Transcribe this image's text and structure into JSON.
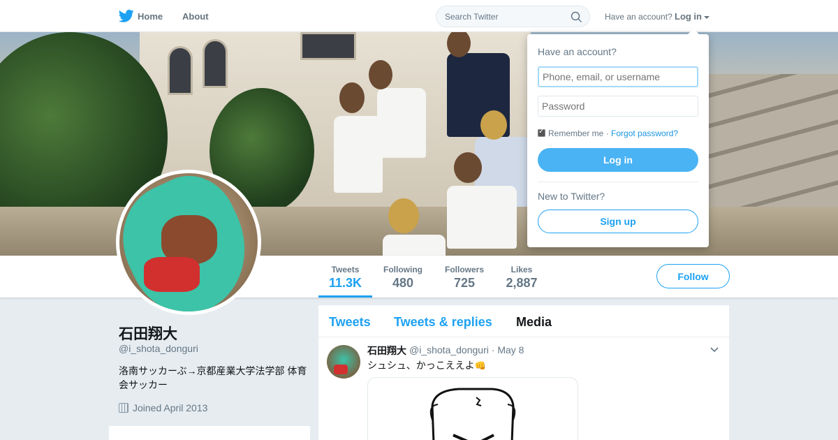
{
  "nav": {
    "home": "Home",
    "about": "About",
    "search_placeholder": "Search Twitter",
    "have_account": "Have an account?",
    "login": "Log in"
  },
  "profile": {
    "name": "石田翔大",
    "handle": "@i_shota_donguri",
    "bio": "洛南サッカーぶ→京都産業大学法学部 体育会サッカー",
    "joined": "Joined April 2013"
  },
  "stats": [
    {
      "label": "Tweets",
      "value": "11.3K"
    },
    {
      "label": "Following",
      "value": "480"
    },
    {
      "label": "Followers",
      "value": "725"
    },
    {
      "label": "Likes",
      "value": "2,887"
    }
  ],
  "follow_label": "Follow",
  "timeline": {
    "tabs": [
      "Tweets",
      "Tweets & replies",
      "Media"
    ],
    "active_tab": "Media",
    "tweet": {
      "name": "石田翔大",
      "handle": "@i_shota_donguri",
      "date": "May 8",
      "text": "シュシュ、かっこええよ"
    }
  },
  "login_dropdown": {
    "title": "Have an account?",
    "username_placeholder": "Phone, email, or username",
    "password_placeholder": "Password",
    "remember": "Remember me",
    "forgot": "Forgot password?",
    "login_button": "Log in",
    "new_to_twitter": "New to Twitter?",
    "signup_button": "Sign up"
  },
  "colors": {
    "accent": "#1da1f2",
    "background": "#e6ecf0"
  }
}
